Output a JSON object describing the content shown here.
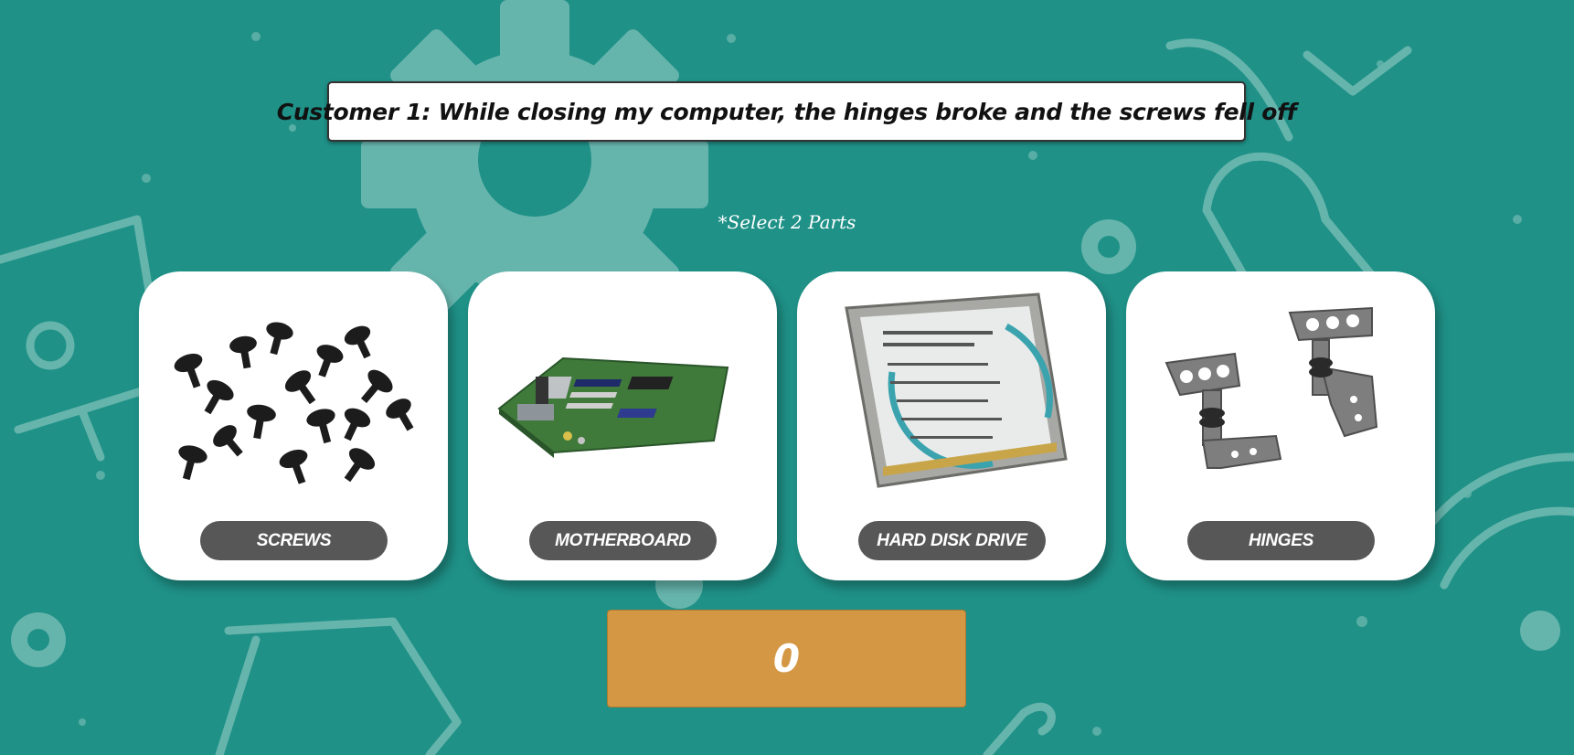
{
  "prompt": "Customer 1: While closing my computer, the hinges broke and the screws fell off",
  "hint": "*Select 2 Parts",
  "parts": [
    {
      "label": "SCREWS",
      "icon": "screws-image"
    },
    {
      "label": "MOTHERBOARD",
      "icon": "motherboard-image"
    },
    {
      "label": "HARD DISK DRIVE",
      "icon": "hard-disk-drive-image"
    },
    {
      "label": "HINGES",
      "icon": "hinges-image"
    }
  ],
  "counter": "0",
  "colors": {
    "background": "#1f9187",
    "pill": "#575757",
    "counter": "#d49844"
  }
}
